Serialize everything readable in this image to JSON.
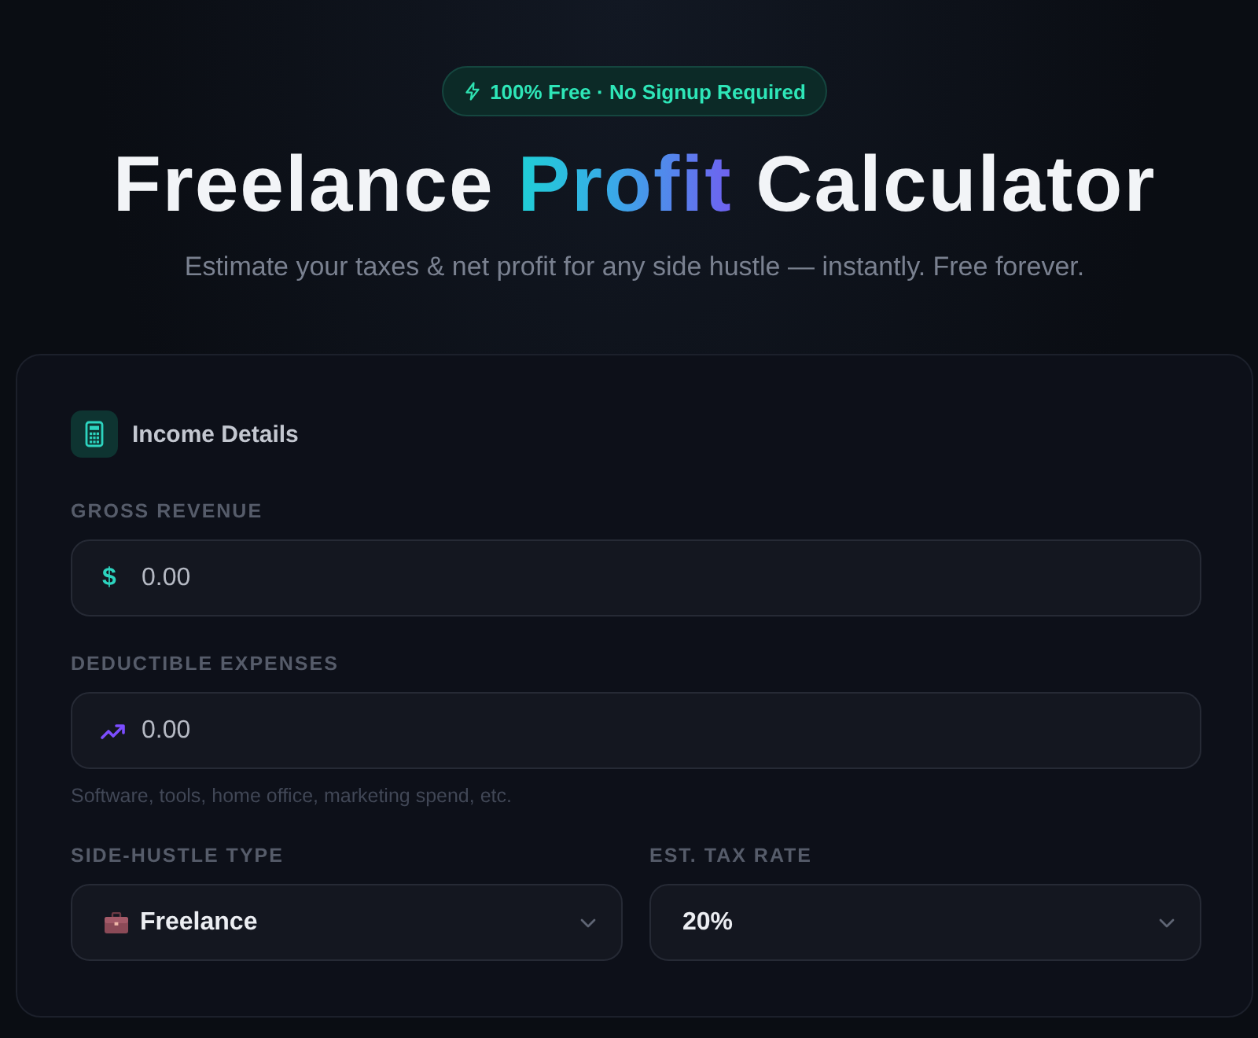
{
  "badge": {
    "text": "100% Free · No Signup Required"
  },
  "title": [
    {
      "text": "Freelance ",
      "highlight": false
    },
    {
      "text": "Profit",
      "highlight": true
    },
    {
      "text": " Calculator",
      "highlight": false
    }
  ],
  "subtitle": "Estimate your taxes & net profit for any side hustle — instantly. Free forever.",
  "card": {
    "heading": "Income Details",
    "fields": [
      {
        "kind": "currency",
        "label": "GROSS REVENUE",
        "prefix": "$",
        "placeholder": "0.00"
      },
      {
        "kind": "expense",
        "label": "DEDUCTIBLE EXPENSES",
        "placeholder": "0.00",
        "hint": "Software, tools, home office, marketing spend, etc."
      }
    ],
    "selects": [
      {
        "kind": "category",
        "label": "SIDE-HUSTLE TYPE",
        "value": "Freelance"
      },
      {
        "kind": "rate",
        "label": "EST. TAX RATE",
        "value": "20%"
      }
    ]
  }
}
